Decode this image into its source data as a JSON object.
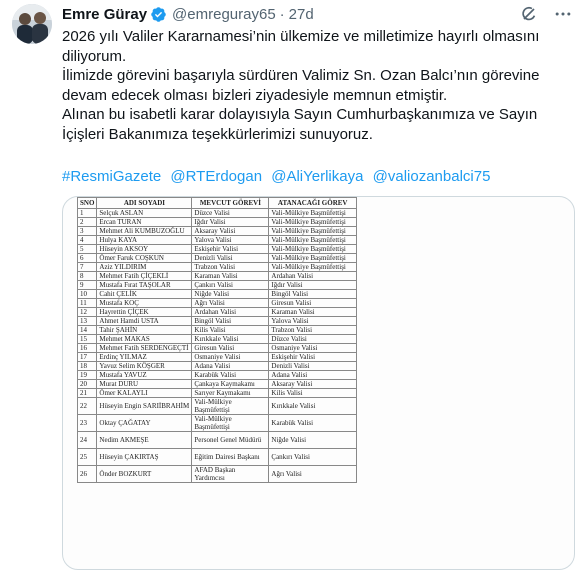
{
  "tweet": {
    "author_name": "Emre Güray",
    "author_handle": "@emreguray65",
    "separator": "·",
    "time": "27d",
    "paragraphs": [
      "2026 yılı Valiler Kararnamesi’nin ülkemize ve milletimize hayırlı olmasını diliyorum.",
      "İlimizde görevini başarıyla sürdüren Valimiz Sn. Ozan Balcı’nın görevine devam edecek olması bizleri ziyadesiyle memnun etmiştir.",
      "Alınan bu isabetli karar dolayısıyla Sayın Cumhurbaşkanımıza ve Sayın İçişleri Bakanımıza teşekkürlerimizi sunuyoruz."
    ],
    "hashtags": [
      "#ResmiGazete",
      "@RTErdogan",
      "@AliYerlikaya",
      "@valiozanbalci75"
    ]
  },
  "icons": {
    "verified": "verified-badge-icon",
    "grok": "grok-icon",
    "more": "more-icon",
    "verified_color": "#1d9bf0"
  },
  "decree_table": {
    "headers": [
      "SNO",
      "ADI SOYADI",
      "MEVCUT GÖREVİ",
      "ATANACAĞI GÖREV"
    ],
    "rows": [
      [
        "1",
        "Selçuk ASLAN",
        "Düzce Valisi",
        "Vali-Mülkiye Başmüfettişi"
      ],
      [
        "2",
        "Ercan TURAN",
        "Iğdır Valisi",
        "Vali-Mülkiye Başmüfettişi"
      ],
      [
        "3",
        "Mehmet Ali KUMBUZOĞLU",
        "Aksaray Valisi",
        "Vali-Mülkiye Başmüfettişi"
      ],
      [
        "4",
        "Hulya KAYA",
        "Yalova Valisi",
        "Vali-Mülkiye Başmüfettişi"
      ],
      [
        "5",
        "Hüseyin AKSOY",
        "Eskişehir Valisi",
        "Vali-Mülkiye Başmüfettişi"
      ],
      [
        "6",
        "Ömer Faruk COŞKUN",
        "Denizli Valisi",
        "Vali-Mülkiye Başmüfettişi"
      ],
      [
        "7",
        "Aziz YILDIRIM",
        "Trabzon Valisi",
        "Vali-Mülkiye Başmüfettişi"
      ],
      [
        "8",
        "Mehmet Fatih ÇİÇEKLİ",
        "Karaman Valisi",
        "Ardahan Valisi"
      ],
      [
        "9",
        "Mustafa Fırat TAŞOLAR",
        "Çankırı Valisi",
        "Iğdır Valisi"
      ],
      [
        "10",
        "Cahit ÇELİK",
        "Niğde Valisi",
        "Bingöl Valisi"
      ],
      [
        "11",
        "Mustafa KOÇ",
        "Ağrı Valisi",
        "Giresun Valisi"
      ],
      [
        "12",
        "Hayrettin ÇİÇEK",
        "Ardahan Valisi",
        "Karaman Valisi"
      ],
      [
        "13",
        "Ahmet Hamdi USTA",
        "Bingöl Valisi",
        "Yalova Valisi"
      ],
      [
        "14",
        "Tahir ŞAHİN",
        "Kilis Valisi",
        "Trabzon Valisi"
      ],
      [
        "15",
        "Mehmet MAKAS",
        "Kırıkkale Valisi",
        "Düzce Valisi"
      ],
      [
        "16",
        "Mehmet Fatih SERDENGEÇTİ",
        "Giresun Valisi",
        "Osmaniye Valisi"
      ],
      [
        "17",
        "Erdinç YILMAZ",
        "Osmaniye Valisi",
        "Eskişehir Valisi"
      ],
      [
        "18",
        "Yavuz Selim KÖŞGER",
        "Adana Valisi",
        "Denizli Valisi"
      ],
      [
        "19",
        "Mustafa YAVUZ",
        "Karabük Valisi",
        "Adana Valisi"
      ],
      [
        "20",
        "Murat DURU",
        "Çankaya Kaymakamı",
        "Aksaray Valisi"
      ],
      [
        "21",
        "Ömer KALAYLI",
        "Sarıyer Kaymakamı",
        "Kilis Valisi"
      ],
      [
        "22",
        "Hüseyin Engin SARIİBRAHİM",
        "Vali-Mülkiye Başmüfettişi",
        "Kırıkkale Valisi"
      ],
      [
        "23",
        "Oktay ÇAĞATAY",
        "Vali-Mülkiye Başmüfettişi",
        "Karabük Valisi"
      ],
      [
        "24",
        "Nedim AKMEŞE",
        "Personel Genel Müdürü",
        "Niğde Valisi"
      ],
      [
        "25",
        "Hüseyin ÇAKIRTAŞ",
        "Eğitim Dairesi Başkanı",
        "Çankırı Valisi"
      ],
      [
        "26",
        "Önder BOZKURT",
        "AFAD Başkan Yardımcısı",
        "Ağrı Valisi"
      ]
    ]
  }
}
